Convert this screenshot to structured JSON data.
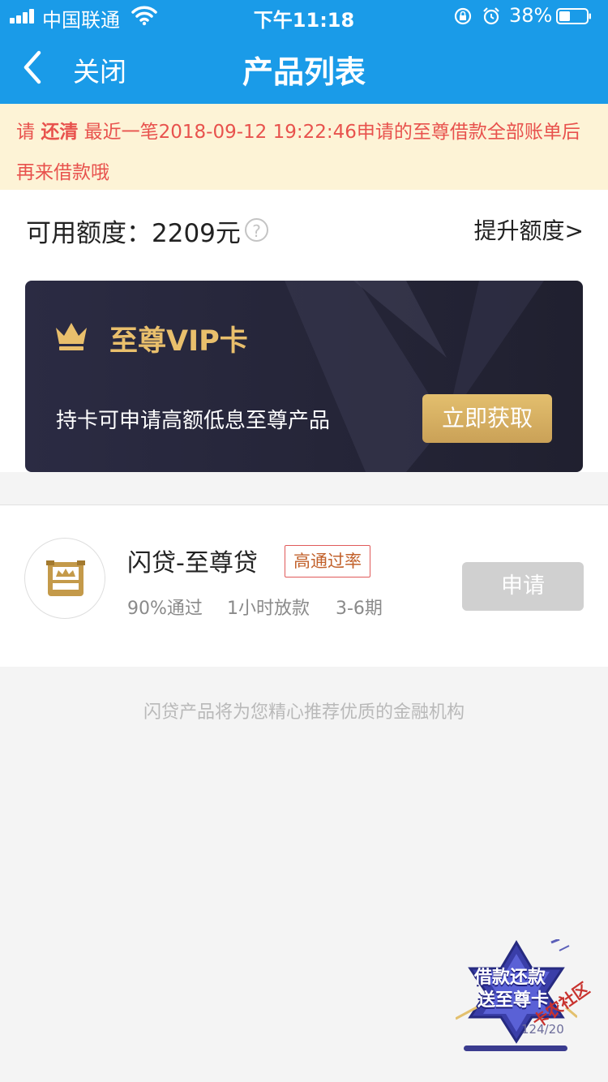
{
  "status_bar": {
    "carrier": "中国联通",
    "time": "下午11:18",
    "battery": "38%"
  },
  "nav": {
    "close_label": "关闭",
    "title": "产品列表"
  },
  "notice": {
    "prefix": "请",
    "action": "还清",
    "message": "最近一笔2018-09-12 19:22:46申请的至尊借款全部账单后再来借款哦"
  },
  "credit": {
    "label": "可用额度：",
    "amount": "2209元",
    "help_symbol": "?",
    "raise_link": "提升额度>"
  },
  "vip_card": {
    "title": "至尊VIP卡",
    "description": "持卡可申请高额低息至尊产品",
    "button": "立即获取"
  },
  "product": {
    "name": "闪贷-至尊贷",
    "tag": "高通过率",
    "meta": [
      "90%通过",
      "1小时放款",
      "3-6期"
    ],
    "apply": "申请"
  },
  "footer_note": "闪贷产品将为您精心推荐优质的金融机构",
  "promo": {
    "line1": "借款还款",
    "line2": "送至尊卡",
    "count": "124/20"
  },
  "watermark": "卡农社区",
  "colors": {
    "header": "#1a9be8",
    "notice_bg": "#fdf3d6",
    "notice_text": "#e8524d",
    "vip_gold": "#e9bf6c",
    "vip_bg": "#24243a"
  }
}
